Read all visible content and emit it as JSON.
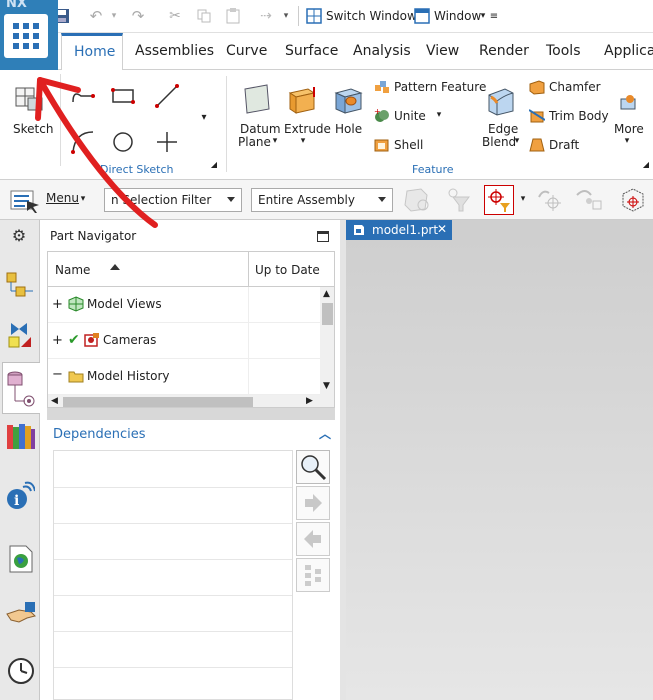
{
  "app": {
    "logo_text": "NX"
  },
  "qat": {
    "switch_window": "Switch Window",
    "window": "Window"
  },
  "tabs": [
    "Home",
    "Assemblies",
    "Curve",
    "Surface",
    "Analysis",
    "View",
    "Render",
    "Tools",
    "Applicatio"
  ],
  "ribbon": {
    "sketch": "Sketch",
    "direct_sketch": "Direct Sketch",
    "datum_plane_1": "Datum",
    "datum_plane_2": "Plane",
    "extrude": "Extrude",
    "hole": "Hole",
    "pattern_feature": "Pattern Feature",
    "unite": "Unite",
    "shell": "Shell",
    "edge_blend_1": "Edge",
    "edge_blend_2": "Blend",
    "chamfer": "Chamfer",
    "trim_body": "Trim Body",
    "draft": "Draft",
    "more": "More",
    "feature_group": "Feature"
  },
  "selection": {
    "menu": "Menu",
    "filter": "No Selection Filter",
    "filter_visible": "n Selection Filter",
    "assembly": "Entire Assembly"
  },
  "navigator": {
    "title": "Part Navigator",
    "col_name": "Name",
    "col_uptodate": "Up to Date",
    "rows": [
      "Model Views",
      "Cameras",
      "Model History"
    ],
    "dependencies": "Dependencies"
  },
  "graphics": {
    "tab": "model1.prt"
  },
  "colors": {
    "accent": "#2a6fb5",
    "arrow": "#e02020",
    "tab_blue": "#2a6fb5"
  }
}
